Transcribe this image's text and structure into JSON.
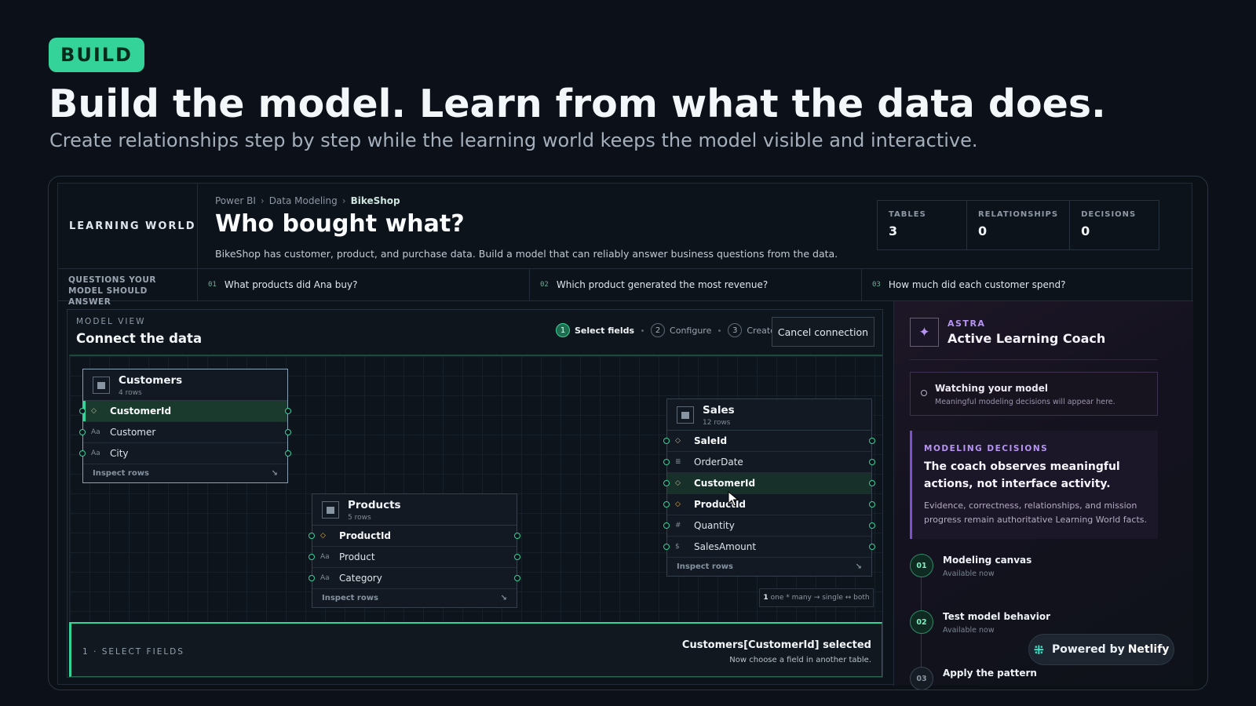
{
  "hero": {
    "badge": "BUILD",
    "title": "Build the model. Learn from what the data does.",
    "subtitle": "Create relationships step by step while the learning world keeps the model visible and interactive."
  },
  "world": {
    "brand": "LEARNING WORLD",
    "breadcrumb": [
      "Power BI",
      "Data Modeling",
      "BikeShop"
    ],
    "title": "Who bought what?",
    "description": "BikeShop has customer, product, and purchase data. Build a model that can reliably answer business questions from the data.",
    "stats": [
      {
        "label": "TABLES",
        "value": "3"
      },
      {
        "label": "RELATIONSHIPS",
        "value": "0"
      },
      {
        "label": "DECISIONS",
        "value": "0"
      }
    ],
    "questions_label": "QUESTIONS YOUR MODEL SHOULD ANSWER",
    "questions": [
      {
        "num": "01",
        "text": "What products did Ana buy?"
      },
      {
        "num": "02",
        "text": "Which product generated the most revenue?"
      },
      {
        "num": "03",
        "text": "How much did each customer spend?"
      }
    ]
  },
  "model_view": {
    "label": "MODEL VIEW",
    "title": "Connect the data",
    "steps": [
      {
        "num": "1",
        "label": "Select fields",
        "active": true
      },
      {
        "num": "2",
        "label": "Configure",
        "active": false
      },
      {
        "num": "3",
        "label": "Create",
        "active": false
      }
    ],
    "cancel_label": "Cancel connection",
    "inspect_label": "Inspect rows",
    "tables": {
      "customers": {
        "name": "Customers",
        "rows": "4 rows",
        "fields": [
          {
            "icon": "◇",
            "name": "CustomerId"
          },
          {
            "icon": "Aa",
            "name": "Customer"
          },
          {
            "icon": "Aa",
            "name": "City"
          }
        ]
      },
      "products": {
        "name": "Products",
        "rows": "5 rows",
        "fields": [
          {
            "icon": "◇",
            "name": "ProductId"
          },
          {
            "icon": "Aa",
            "name": "Product"
          },
          {
            "icon": "Aa",
            "name": "Category"
          }
        ]
      },
      "sales": {
        "name": "Sales",
        "rows": "12 rows",
        "fields": [
          {
            "icon": "◇",
            "name": "SaleId"
          },
          {
            "icon": "≣",
            "name": "OrderDate"
          },
          {
            "icon": "◇",
            "name": "CustomerId"
          },
          {
            "icon": "◇",
            "name": "ProductId"
          },
          {
            "icon": "#",
            "name": "Quantity"
          },
          {
            "icon": "$",
            "name": "SalesAmount"
          }
        ]
      }
    },
    "legend": {
      "one": "1",
      "rest": "one * many → single ↔ both"
    },
    "select_fields": {
      "label": "1 · SELECT FIELDS",
      "message": "Customers[CustomerId] selected",
      "sub": "Now choose a field in another table."
    }
  },
  "coach": {
    "name": "ASTRA",
    "role": "Active Learning Coach",
    "watching_title": "Watching your model",
    "watching_sub": "Meaningful modeling decisions will appear here.",
    "decisions_label": "MODELING DECISIONS",
    "decisions_title": "The coach observes meaningful actions, not interface activity.",
    "decisions_body": "Evidence, correctness, relationships, and mission progress remain authoritative Learning World facts.",
    "milestones": [
      {
        "num": "01",
        "title": "Modeling canvas",
        "status": "Available now"
      },
      {
        "num": "02",
        "title": "Test model behavior",
        "status": "Available now"
      },
      {
        "num": "03",
        "title": "Apply the pattern",
        "status": ""
      }
    ]
  },
  "netlify": {
    "prefix": "Powered by",
    "brand": "Netlify"
  },
  "colors": {
    "accent": "#34d399",
    "coach_accent": "#b794f4",
    "background": "#0c1119"
  }
}
